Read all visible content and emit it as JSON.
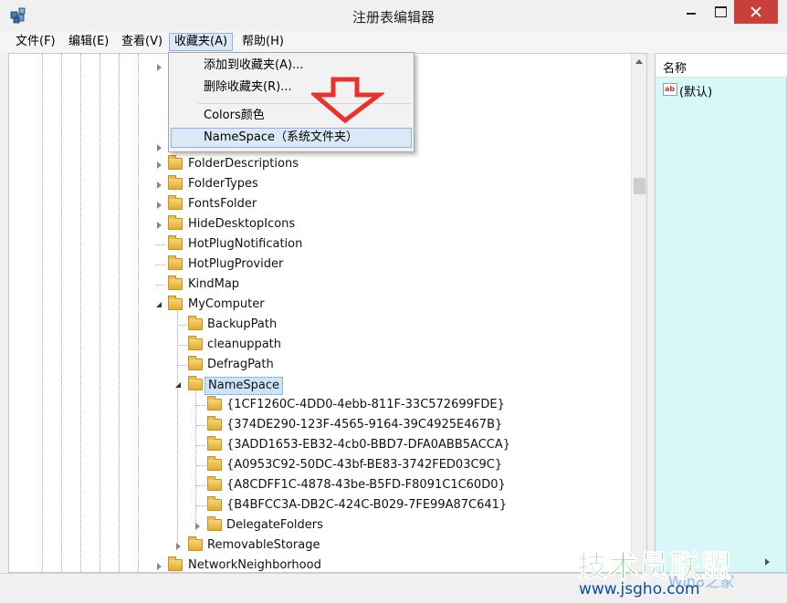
{
  "window": {
    "title": "注册表编辑器"
  },
  "menu": {
    "items": [
      "文件(F)",
      "编辑(E)",
      "查看(V)",
      "收藏夹(A)",
      "帮助(H)"
    ],
    "active": "收藏夹(A)"
  },
  "favorites_menu": {
    "items": [
      "添加到收藏夹(A)...",
      "删除收藏夹(R)...",
      "Colors颜色",
      "NameSpace（系统文件夹）"
    ],
    "highlighted": "NameSpace（系统文件夹）"
  },
  "tree": {
    "nodes": [
      {
        "label": "FolderDescriptions",
        "state": "collapsed"
      },
      {
        "label": "FolderTypes",
        "state": "collapsed"
      },
      {
        "label": "FontsFolder",
        "state": "collapsed"
      },
      {
        "label": "HideDesktopIcons",
        "state": "collapsed"
      },
      {
        "label": "HotPlugNotification",
        "state": "leaf"
      },
      {
        "label": "HotPlugProvider",
        "state": "leaf"
      },
      {
        "label": "KindMap",
        "state": "leaf"
      },
      {
        "label": "MyComputer",
        "state": "expanded"
      },
      {
        "label": "BackupPath",
        "state": "leaf"
      },
      {
        "label": "cleanuppath",
        "state": "leaf"
      },
      {
        "label": "DefragPath",
        "state": "leaf"
      },
      {
        "label": "NameSpace",
        "state": "expanded",
        "selected": true
      },
      {
        "label": "{1CF1260C-4DD0-4ebb-811F-33C572699FDE}",
        "state": "leaf"
      },
      {
        "label": "{374DE290-123F-4565-9164-39C4925E467B}",
        "state": "leaf"
      },
      {
        "label": "{3ADD1653-EB32-4cb0-BBD7-DFA0ABB5ACCA}",
        "state": "leaf"
      },
      {
        "label": "{A0953C92-50DC-43bf-BE83-3742FED03C9C}",
        "state": "leaf"
      },
      {
        "label": "{A8CDFF1C-4878-43be-B5FD-F8091C1C60D0}",
        "state": "leaf"
      },
      {
        "label": "{B4BFCC3A-DB2C-424C-B029-7FE99A87C641}",
        "state": "leaf"
      },
      {
        "label": "DelegateFolders",
        "state": "collapsed"
      },
      {
        "label": "RemovableStorage",
        "state": "collapsed"
      },
      {
        "label": "NetworkNeighborhood",
        "state": "collapsed"
      }
    ]
  },
  "values_pane": {
    "column_name": "名称",
    "rows": [
      {
        "icon": "string-value-icon",
        "name": "(默认)"
      }
    ]
  },
  "watermark": {
    "main": "技术员联盟",
    "sub": "www.jsgho.com",
    "ghost": "Win8之家"
  },
  "colors": {
    "close_button": "#c7413a",
    "values_pane_bg": "#d8f7f8",
    "red_arrow": "#e8322b",
    "watermark_green": "#2fb138"
  }
}
